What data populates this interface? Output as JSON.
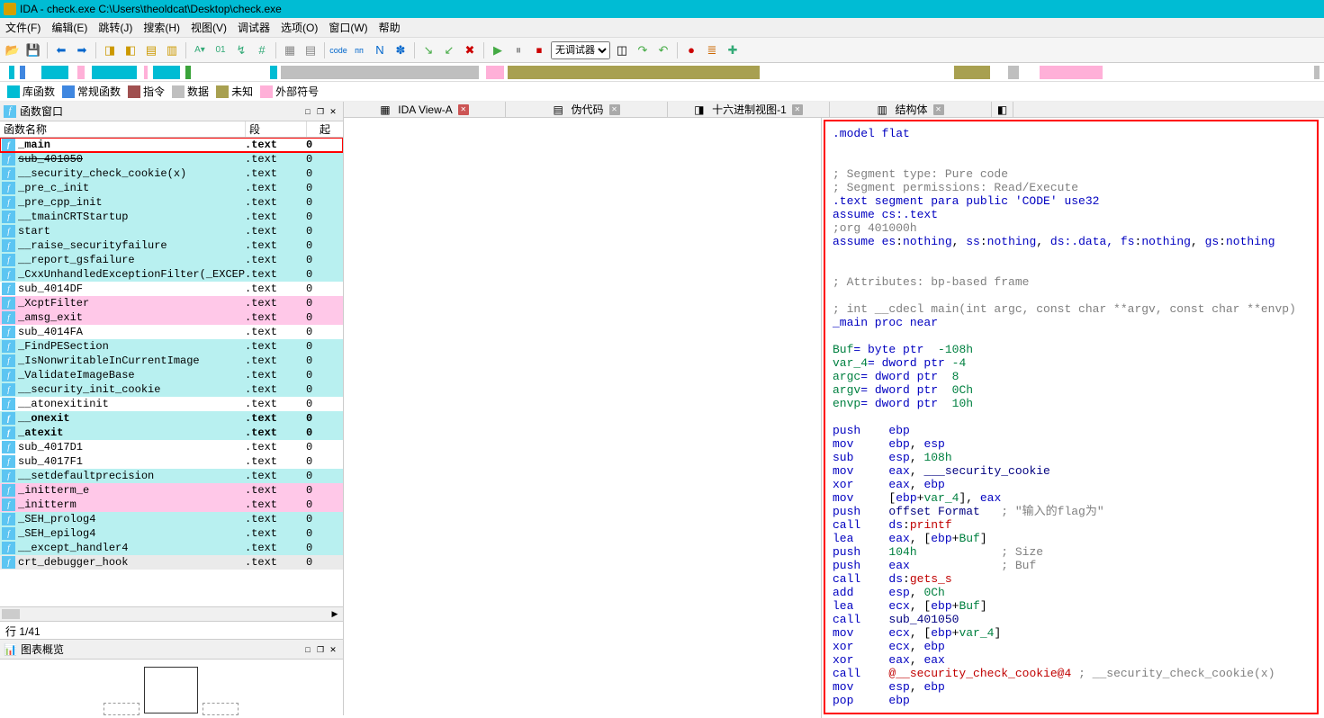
{
  "title": "IDA - check.exe C:\\Users\\theoldcat\\Desktop\\check.exe",
  "menu": [
    "文件(F)",
    "编辑(E)",
    "跳转(J)",
    "搜索(H)",
    "视图(V)",
    "调试器",
    "选项(O)",
    "窗口(W)",
    "帮助"
  ],
  "debugger_select": "无调试器",
  "legend": [
    {
      "color": "#00bcd4",
      "label": "库函数"
    },
    {
      "color": "#3f87e0",
      "label": "常规函数"
    },
    {
      "color": "#a05050",
      "label": "指令"
    },
    {
      "color": "#bfbfbf",
      "label": "数据"
    },
    {
      "color": "#a8a050",
      "label": "未知"
    },
    {
      "color": "#ffb0d8",
      "label": "外部符号"
    }
  ],
  "func_window": {
    "title": "函数窗口",
    "col_name": "函数名称",
    "col_seg": "段",
    "col_ov": "起",
    "rows": [
      {
        "name": "_main",
        "seg": ".text",
        "ov": "0",
        "bold": true,
        "selected": true,
        "bg": ""
      },
      {
        "name": "sub_401050",
        "seg": ".text",
        "ov": "0",
        "strike": true,
        "bg": "bg-cyan"
      },
      {
        "name": "__security_check_cookie(x)",
        "seg": ".text",
        "ov": "0",
        "bg": "bg-cyan"
      },
      {
        "name": "_pre_c_init",
        "seg": ".text",
        "ov": "0",
        "bg": "bg-cyan"
      },
      {
        "name": "_pre_cpp_init",
        "seg": ".text",
        "ov": "0",
        "bg": "bg-cyan"
      },
      {
        "name": "__tmainCRTStartup",
        "seg": ".text",
        "ov": "0",
        "bg": "bg-cyan"
      },
      {
        "name": "start",
        "seg": ".text",
        "ov": "0",
        "bg": "bg-cyan"
      },
      {
        "name": "__raise_securityfailure",
        "seg": ".text",
        "ov": "0",
        "bg": "bg-cyan"
      },
      {
        "name": "__report_gsfailure",
        "seg": ".text",
        "ov": "0",
        "bg": "bg-cyan"
      },
      {
        "name": "_CxxUnhandledExceptionFilter(_EXCEPTI…",
        "seg": ".text",
        "ov": "0",
        "bg": "bg-cyan"
      },
      {
        "name": "sub_4014DF",
        "seg": ".text",
        "ov": "0",
        "bg": ""
      },
      {
        "name": "_XcptFilter",
        "seg": ".text",
        "ov": "0",
        "bg": "bg-pink"
      },
      {
        "name": "_amsg_exit",
        "seg": ".text",
        "ov": "0",
        "bg": "bg-pink"
      },
      {
        "name": "sub_4014FA",
        "seg": ".text",
        "ov": "0",
        "bg": ""
      },
      {
        "name": "_FindPESection",
        "seg": ".text",
        "ov": "0",
        "bg": "bg-cyan"
      },
      {
        "name": "_IsNonwritableInCurrentImage",
        "seg": ".text",
        "ov": "0",
        "bg": "bg-cyan"
      },
      {
        "name": "_ValidateImageBase",
        "seg": ".text",
        "ov": "0",
        "bg": "bg-cyan"
      },
      {
        "name": "__security_init_cookie",
        "seg": ".text",
        "ov": "0",
        "bg": "bg-cyan"
      },
      {
        "name": "__atonexitinit",
        "seg": ".text",
        "ov": "0",
        "bg": ""
      },
      {
        "name": "__onexit",
        "seg": ".text",
        "ov": "0",
        "bold": true,
        "bg": "bg-cyan"
      },
      {
        "name": "_atexit",
        "seg": ".text",
        "ov": "0",
        "bold": true,
        "bg": "bg-cyan"
      },
      {
        "name": "sub_4017D1",
        "seg": ".text",
        "ov": "0",
        "bg": ""
      },
      {
        "name": "sub_4017F1",
        "seg": ".text",
        "ov": "0",
        "bg": ""
      },
      {
        "name": "__setdefaultprecision",
        "seg": ".text",
        "ov": "0",
        "bg": "bg-cyan"
      },
      {
        "name": "_initterm_e",
        "seg": ".text",
        "ov": "0",
        "bg": "bg-pink"
      },
      {
        "name": "_initterm",
        "seg": ".text",
        "ov": "0",
        "bg": "bg-pink"
      },
      {
        "name": "_SEH_prolog4",
        "seg": ".text",
        "ov": "0",
        "bg": "bg-cyan"
      },
      {
        "name": "_SEH_epilog4",
        "seg": ".text",
        "ov": "0",
        "bg": "bg-cyan"
      },
      {
        "name": "__except_handler4",
        "seg": ".text",
        "ov": "0",
        "bg": "bg-cyan"
      },
      {
        "name": "crt_debugger_hook",
        "seg": ".text",
        "ov": "0",
        "bg": "bg-gray"
      }
    ],
    "status": "行 1/41"
  },
  "chart_title": "图表概览",
  "tabs": [
    {
      "label": "IDA View-A",
      "close": "red"
    },
    {
      "label": "伪代码",
      "close": "gray"
    },
    {
      "label": "十六进制视图-1",
      "close": "gray"
    },
    {
      "label": "结构体",
      "close": "gray"
    }
  ],
  "disasm_lines": [
    [
      {
        "t": ".model flat",
        "c": "c-dir"
      }
    ],
    [],
    [],
    [
      {
        "t": "; Segment type: Pure code",
        "c": "c-cmt"
      }
    ],
    [
      {
        "t": "; Segment permissions: Read/Execute",
        "c": "c-cmt"
      }
    ],
    [
      {
        "t": ".text segment para public 'CODE' use32",
        "c": "c-dir"
      }
    ],
    [
      {
        "t": "assume ",
        "c": "c-kw"
      },
      {
        "t": "cs",
        "c": "c-reg"
      },
      {
        "t": ":.text",
        "c": "c-dir"
      }
    ],
    [
      {
        "t": ";org 401000h",
        "c": "c-cmt"
      }
    ],
    [
      {
        "t": "assume ",
        "c": "c-kw"
      },
      {
        "t": "es",
        "c": "c-reg"
      },
      {
        "t": ":",
        "c": ""
      },
      {
        "t": "nothing",
        "c": "c-kw"
      },
      {
        "t": ", ",
        "c": ""
      },
      {
        "t": "ss",
        "c": "c-reg"
      },
      {
        "t": ":",
        "c": ""
      },
      {
        "t": "nothing",
        "c": "c-kw"
      },
      {
        "t": ", ",
        "c": ""
      },
      {
        "t": "ds",
        "c": "c-reg"
      },
      {
        "t": ":.data, ",
        "c": "c-dir"
      },
      {
        "t": "fs",
        "c": "c-reg"
      },
      {
        "t": ":",
        "c": ""
      },
      {
        "t": "nothing",
        "c": "c-kw"
      },
      {
        "t": ", ",
        "c": ""
      },
      {
        "t": "gs",
        "c": "c-reg"
      },
      {
        "t": ":",
        "c": ""
      },
      {
        "t": "nothing",
        "c": "c-kw"
      }
    ],
    [],
    [],
    [
      {
        "t": "; Attributes: bp-based frame",
        "c": "c-cmt"
      }
    ],
    [],
    [
      {
        "t": "; int __cdecl main(int argc, const char **argv, const char **envp)",
        "c": "c-cmt"
      }
    ],
    [
      {
        "t": "_main proc near",
        "c": "c-dir"
      }
    ],
    [],
    [
      {
        "t": "Buf",
        "c": "c-var"
      },
      {
        "t": "= byte ptr ",
        "c": "c-dir"
      },
      {
        "t": " -108h",
        "c": "c-num"
      }
    ],
    [
      {
        "t": "var_4",
        "c": "c-var"
      },
      {
        "t": "= dword ptr ",
        "c": "c-dir"
      },
      {
        "t": "-4",
        "c": "c-num"
      }
    ],
    [
      {
        "t": "argc",
        "c": "c-var"
      },
      {
        "t": "= dword ptr ",
        "c": "c-dir"
      },
      {
        "t": " 8",
        "c": "c-num"
      }
    ],
    [
      {
        "t": "argv",
        "c": "c-var"
      },
      {
        "t": "= dword ptr ",
        "c": "c-dir"
      },
      {
        "t": " 0Ch",
        "c": "c-num"
      }
    ],
    [
      {
        "t": "envp",
        "c": "c-var"
      },
      {
        "t": "= dword ptr ",
        "c": "c-dir"
      },
      {
        "t": " 10h",
        "c": "c-num"
      }
    ],
    [],
    [
      {
        "t": "push    ",
        "c": "c-op"
      },
      {
        "t": "ebp",
        "c": "c-reg"
      }
    ],
    [
      {
        "t": "mov     ",
        "c": "c-op"
      },
      {
        "t": "ebp",
        "c": "c-reg"
      },
      {
        "t": ", ",
        "c": ""
      },
      {
        "t": "esp",
        "c": "c-reg"
      }
    ],
    [
      {
        "t": "sub     ",
        "c": "c-op"
      },
      {
        "t": "esp",
        "c": "c-reg"
      },
      {
        "t": ", ",
        "c": ""
      },
      {
        "t": "108h",
        "c": "c-num"
      }
    ],
    [
      {
        "t": "mov     ",
        "c": "c-op"
      },
      {
        "t": "eax",
        "c": "c-reg"
      },
      {
        "t": ", ",
        "c": ""
      },
      {
        "t": "___security_cookie",
        "c": "c-id"
      }
    ],
    [
      {
        "t": "xor     ",
        "c": "c-op"
      },
      {
        "t": "eax",
        "c": "c-reg"
      },
      {
        "t": ", ",
        "c": ""
      },
      {
        "t": "ebp",
        "c": "c-reg"
      }
    ],
    [
      {
        "t": "mov     ",
        "c": "c-op"
      },
      {
        "t": "[",
        "c": ""
      },
      {
        "t": "ebp",
        "c": "c-reg"
      },
      {
        "t": "+",
        "c": ""
      },
      {
        "t": "var_4",
        "c": "c-var"
      },
      {
        "t": "], ",
        "c": ""
      },
      {
        "t": "eax",
        "c": "c-reg"
      }
    ],
    [
      {
        "t": "push    ",
        "c": "c-op"
      },
      {
        "t": "offset Format",
        "c": "c-id"
      },
      {
        "t": "   ; \"输入的flag为\"",
        "c": "c-str"
      }
    ],
    [
      {
        "t": "call    ",
        "c": "c-op"
      },
      {
        "t": "ds",
        "c": "c-reg"
      },
      {
        "t": ":",
        "c": ""
      },
      {
        "t": "printf",
        "c": "c-call"
      }
    ],
    [
      {
        "t": "lea     ",
        "c": "c-op"
      },
      {
        "t": "eax",
        "c": "c-reg"
      },
      {
        "t": ", [",
        "c": ""
      },
      {
        "t": "ebp",
        "c": "c-reg"
      },
      {
        "t": "+",
        "c": ""
      },
      {
        "t": "Buf",
        "c": "c-var"
      },
      {
        "t": "]",
        "c": ""
      }
    ],
    [
      {
        "t": "push    ",
        "c": "c-op"
      },
      {
        "t": "104h",
        "c": "c-num"
      },
      {
        "t": "            ; Size",
        "c": "c-cmt"
      }
    ],
    [
      {
        "t": "push    ",
        "c": "c-op"
      },
      {
        "t": "eax",
        "c": "c-reg"
      },
      {
        "t": "             ; Buf",
        "c": "c-cmt"
      }
    ],
    [
      {
        "t": "call    ",
        "c": "c-op"
      },
      {
        "t": "ds",
        "c": "c-reg"
      },
      {
        "t": ":",
        "c": ""
      },
      {
        "t": "gets_s",
        "c": "c-call"
      }
    ],
    [
      {
        "t": "add     ",
        "c": "c-op"
      },
      {
        "t": "esp",
        "c": "c-reg"
      },
      {
        "t": ", ",
        "c": ""
      },
      {
        "t": "0Ch",
        "c": "c-num"
      }
    ],
    [
      {
        "t": "lea     ",
        "c": "c-op"
      },
      {
        "t": "ecx",
        "c": "c-reg"
      },
      {
        "t": ", [",
        "c": ""
      },
      {
        "t": "ebp",
        "c": "c-reg"
      },
      {
        "t": "+",
        "c": ""
      },
      {
        "t": "Buf",
        "c": "c-var"
      },
      {
        "t": "]",
        "c": ""
      }
    ],
    [
      {
        "t": "call    ",
        "c": "c-op"
      },
      {
        "t": "sub_401050",
        "c": "c-id"
      }
    ],
    [
      {
        "t": "mov     ",
        "c": "c-op"
      },
      {
        "t": "ecx",
        "c": "c-reg"
      },
      {
        "t": ", [",
        "c": ""
      },
      {
        "t": "ebp",
        "c": "c-reg"
      },
      {
        "t": "+",
        "c": ""
      },
      {
        "t": "var_4",
        "c": "c-var"
      },
      {
        "t": "]",
        "c": ""
      }
    ],
    [
      {
        "t": "xor     ",
        "c": "c-op"
      },
      {
        "t": "ecx",
        "c": "c-reg"
      },
      {
        "t": ", ",
        "c": ""
      },
      {
        "t": "ebp",
        "c": "c-reg"
      }
    ],
    [
      {
        "t": "xor     ",
        "c": "c-op"
      },
      {
        "t": "eax",
        "c": "c-reg"
      },
      {
        "t": ", ",
        "c": ""
      },
      {
        "t": "eax",
        "c": "c-reg"
      }
    ],
    [
      {
        "t": "call    ",
        "c": "c-op"
      },
      {
        "t": "@__security_check_cookie@4",
        "c": "c-call"
      },
      {
        "t": " ; __security_check_cookie(x)",
        "c": "c-cmt"
      }
    ],
    [
      {
        "t": "mov     ",
        "c": "c-op"
      },
      {
        "t": "esp",
        "c": "c-reg"
      },
      {
        "t": ", ",
        "c": ""
      },
      {
        "t": "ebp",
        "c": "c-reg"
      }
    ],
    [
      {
        "t": "pop     ",
        "c": "c-op"
      },
      {
        "t": "ebp",
        "c": "c-reg"
      }
    ]
  ]
}
